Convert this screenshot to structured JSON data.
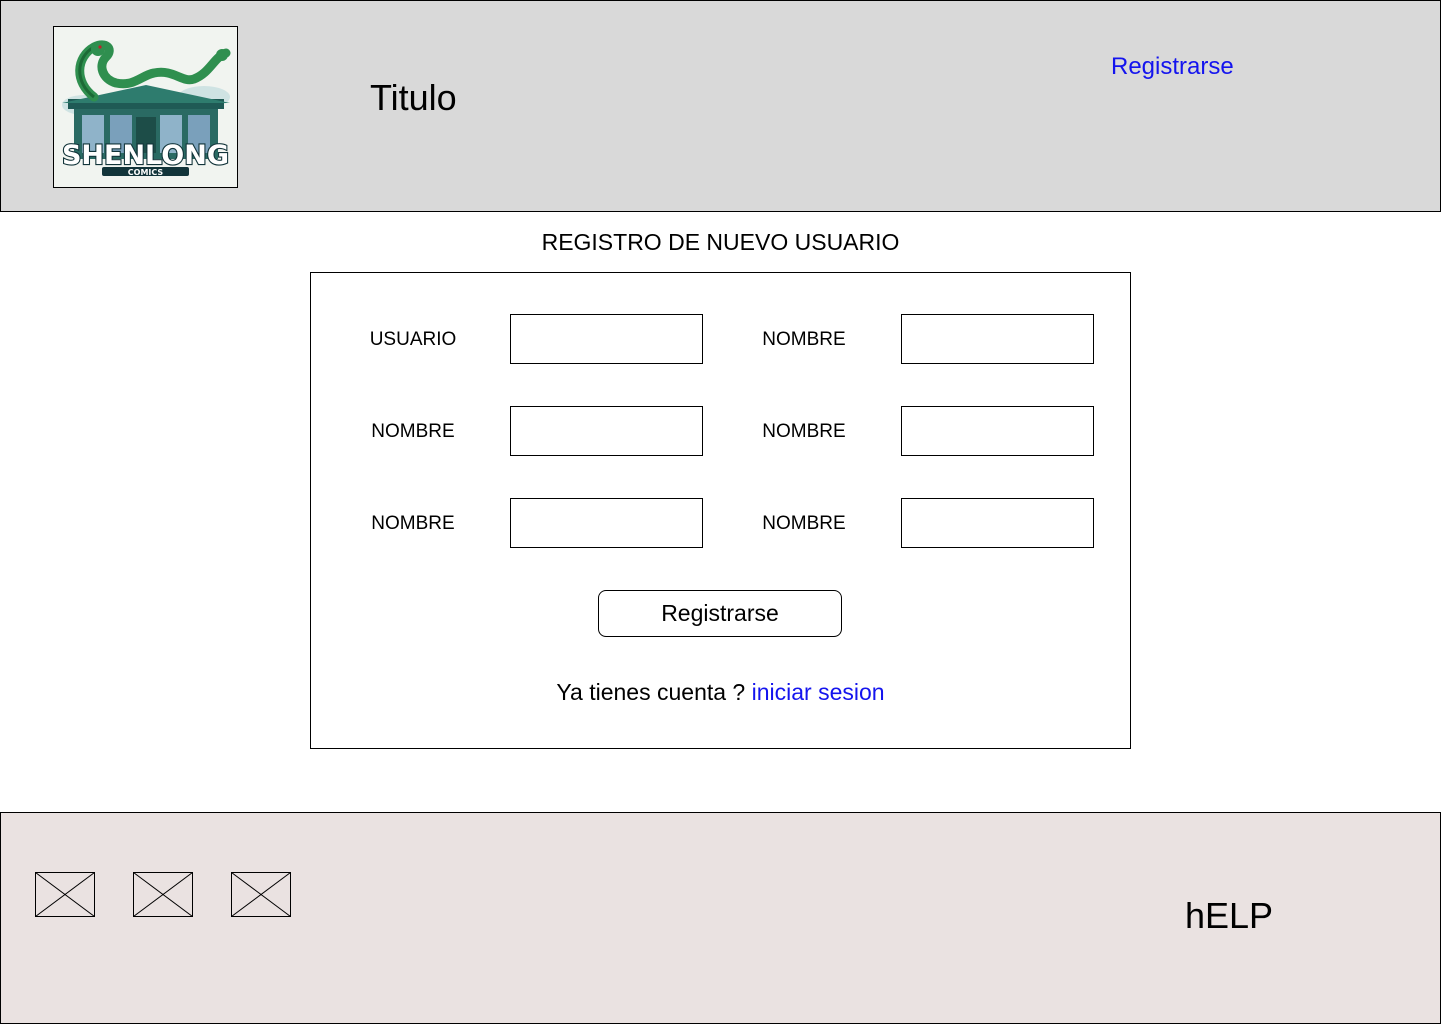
{
  "header": {
    "logo_text": "SHENLONG",
    "logo_subtext": "COMICS",
    "title": "Titulo",
    "register_link": "Registrarse"
  },
  "form": {
    "heading": "REGISTRO DE NUEVO USUARIO",
    "fields": [
      {
        "label": "USUARIO",
        "value": ""
      },
      {
        "label": "NOMBRE",
        "value": ""
      },
      {
        "label": "NOMBRE",
        "value": ""
      },
      {
        "label": "NOMBRE",
        "value": ""
      },
      {
        "label": "NOMBRE",
        "value": ""
      },
      {
        "label": "NOMBRE",
        "value": ""
      }
    ],
    "submit_label": "Registrarse",
    "login_prompt": "Ya tienes cuenta ? ",
    "login_link": "iniciar sesion"
  },
  "footer": {
    "icons": [
      "image-placeholder-icon",
      "image-placeholder-icon",
      "image-placeholder-icon"
    ],
    "help_label": "hELP"
  },
  "colors": {
    "header_bg": "#d9d9d9",
    "footer_bg": "#eae2e1",
    "link": "#1414ee"
  }
}
